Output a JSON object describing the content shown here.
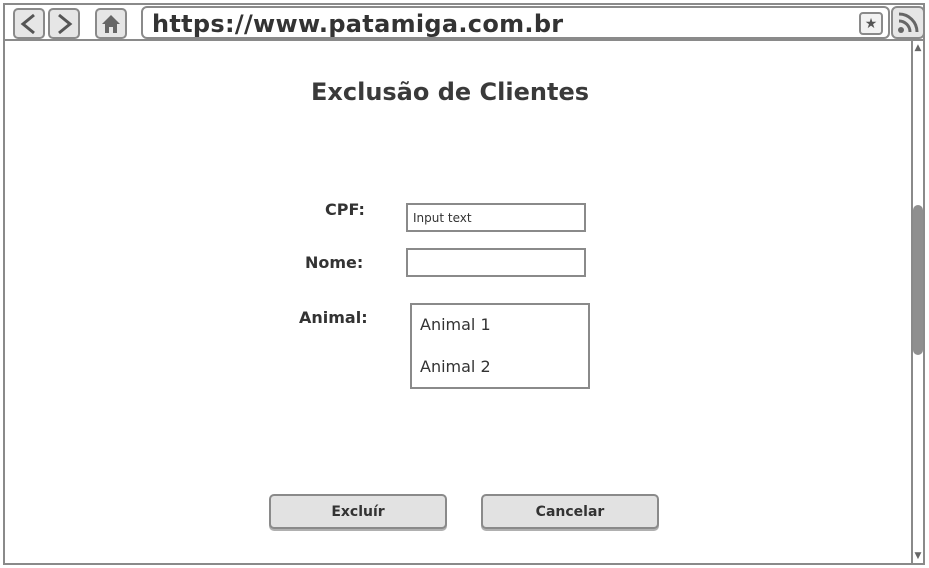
{
  "browser": {
    "url": "https://www.patamiga.com.br",
    "icons": {
      "back": "chevron-left-icon",
      "forward": "chevron-right-icon",
      "home": "home-icon",
      "bookmark": "star-icon",
      "feed": "rss-icon"
    },
    "bookmark_glyph": "★",
    "scroll_up_glyph": "▲",
    "scroll_down_glyph": "▼"
  },
  "page": {
    "title": "Exclusão de Clientes"
  },
  "form": {
    "cpf_label": "CPF:",
    "cpf_placeholder": "Input text",
    "cpf_value": "",
    "nome_label": "Nome:",
    "nome_value": "",
    "animal_label": "Animal:",
    "animals": [
      "Animal 1",
      "Animal 2"
    ]
  },
  "actions": {
    "delete_label": "Excluír",
    "cancel_label": "Cancelar"
  },
  "colors": {
    "border": "#8a8a8a",
    "button_bg": "#e2e2e2",
    "text": "#333333",
    "scroll_thumb": "#8f8f8f"
  }
}
